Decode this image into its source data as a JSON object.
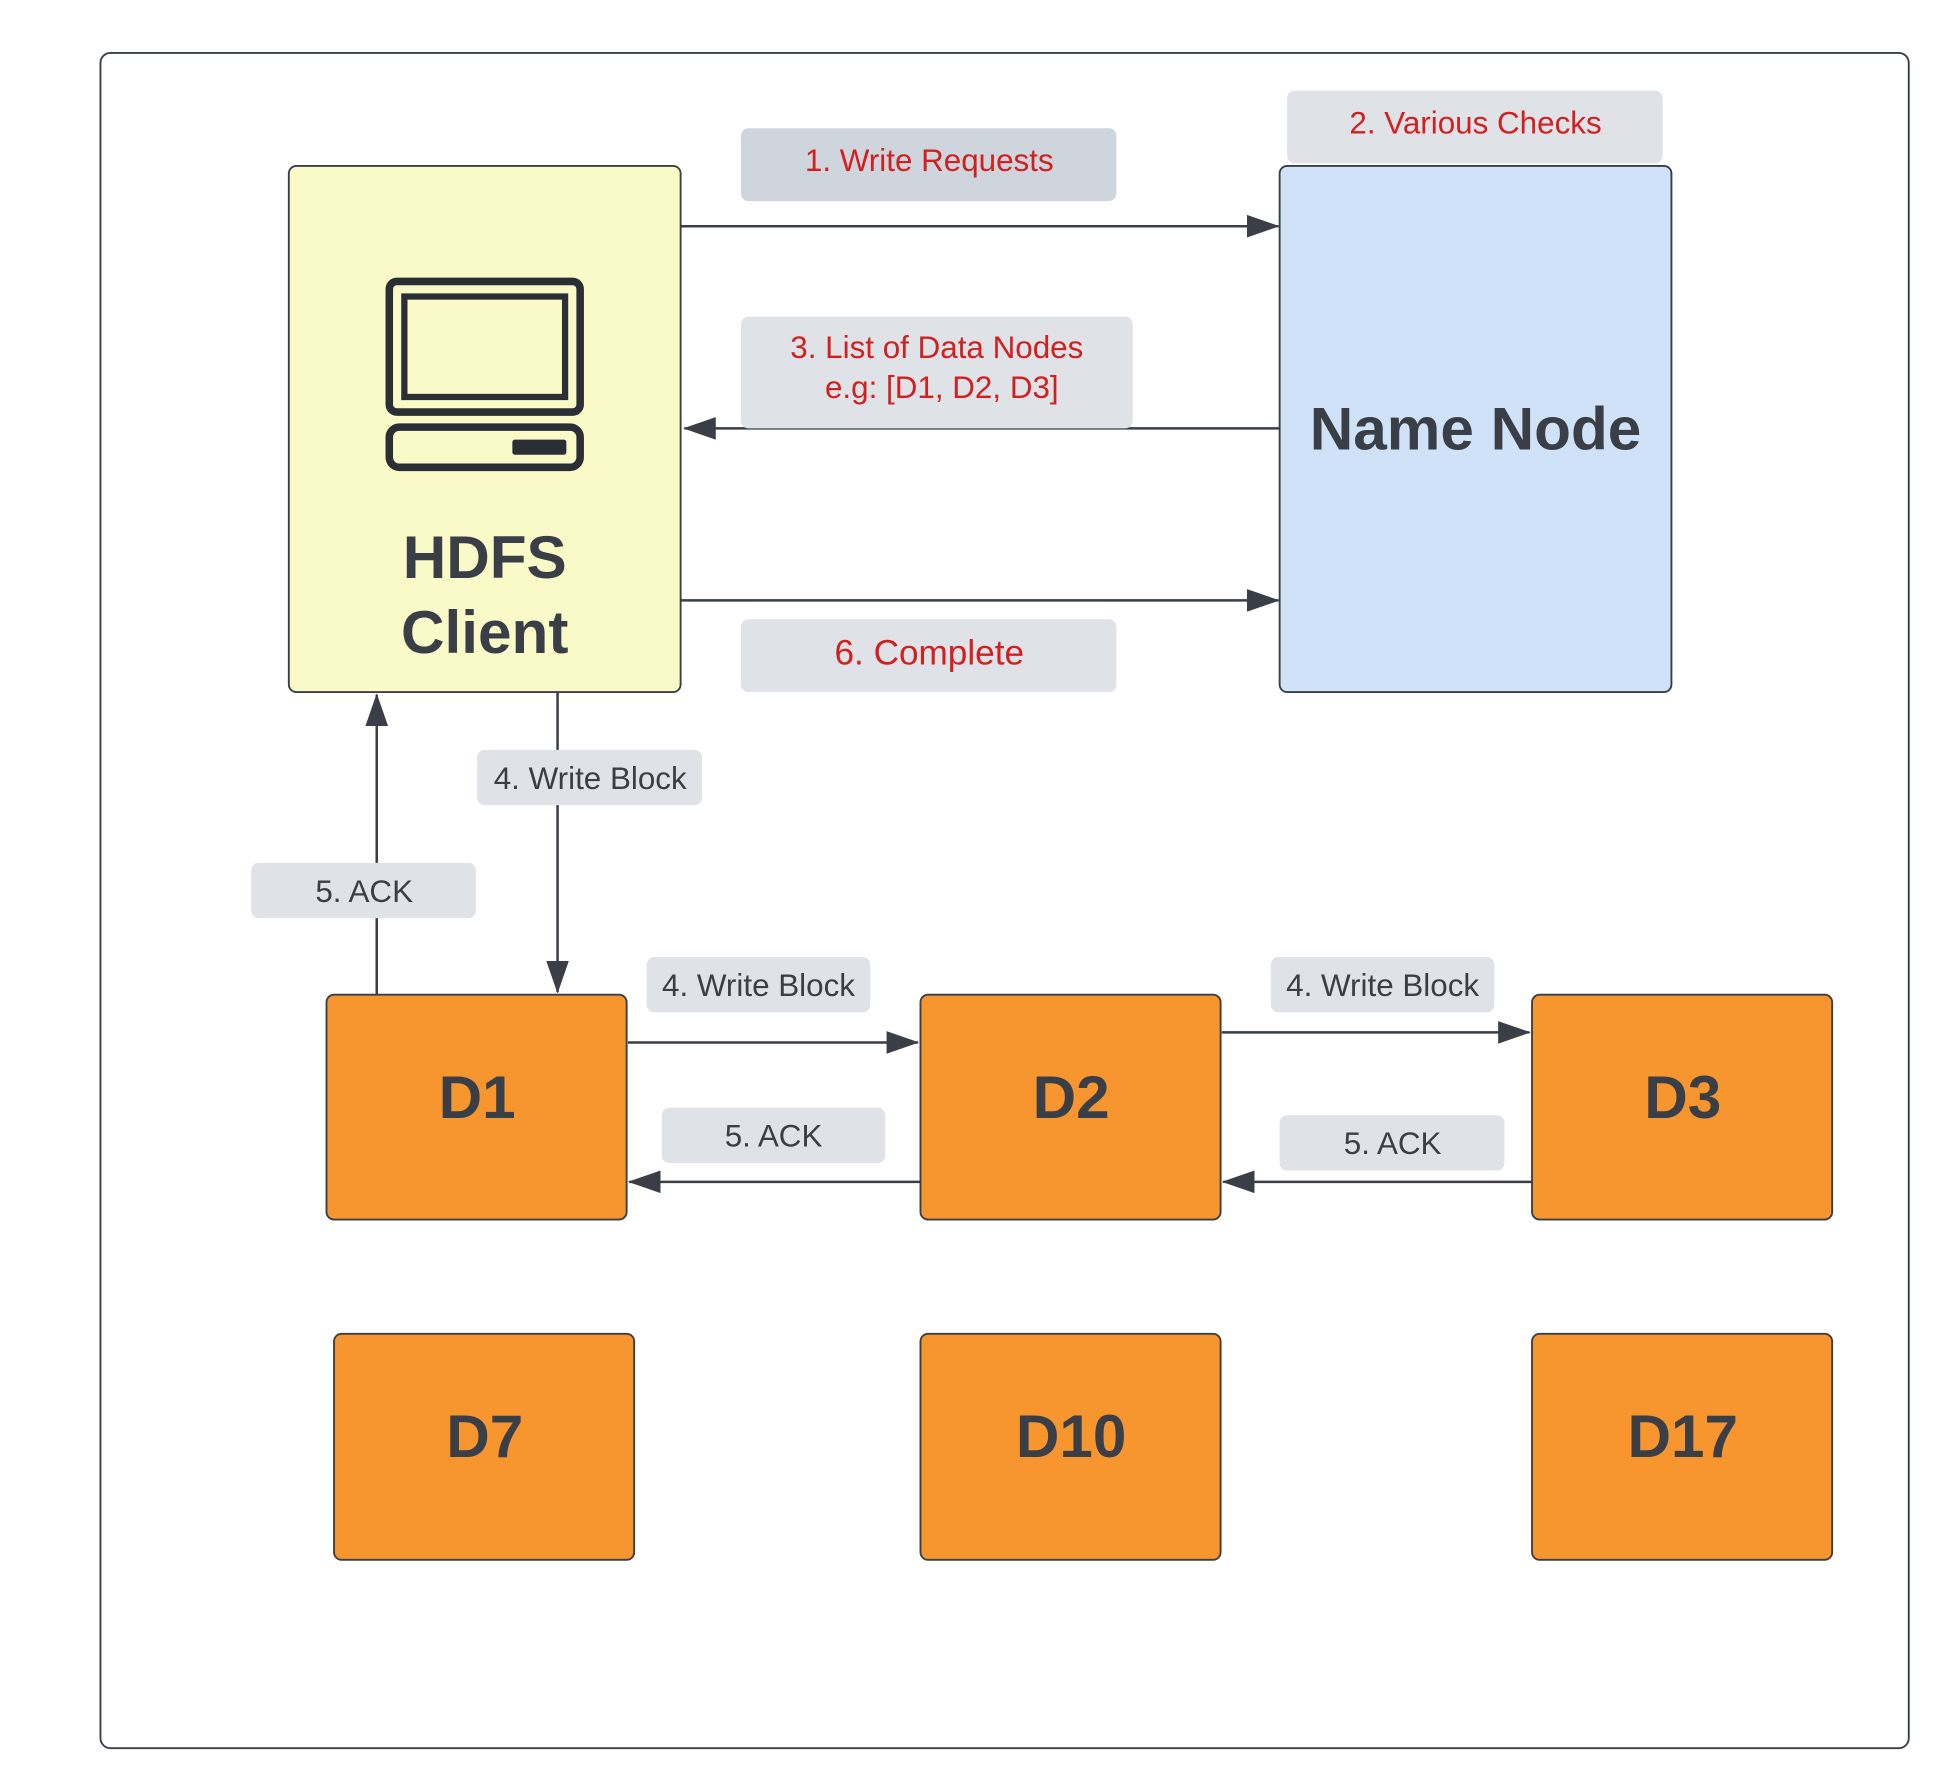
{
  "colors": {
    "client_fill": "#fafac8",
    "namenode_fill": "#cfe2f8",
    "datanode_fill": "#f7952f",
    "label_fill": "#dfe2e6",
    "request_text": "#d21f1f",
    "text_dark": "#3a3f47"
  },
  "client": {
    "title_line1": "HDFS",
    "title_line2": "Client",
    "icon": "computer-monitor-icon"
  },
  "namenode": {
    "title": "Name Node"
  },
  "labels": {
    "write_requests": "1. Write Requests",
    "various_checks": "2. Various Checks",
    "list_line1": "3. List of Data Nodes",
    "list_line2": "e.g: [D1, D2, D3]",
    "complete": "6. Complete",
    "write_block_client": "4. Write Block",
    "ack_client": "5. ACK",
    "write_block_d1_d2": "4. Write Block",
    "write_block_d2_d3": "4. Write Block",
    "ack_d2_d1": "5. ACK",
    "ack_d3_d2": "5. ACK"
  },
  "datanodes": [
    "D1",
    "D2",
    "D3",
    "D7",
    "D10",
    "D17"
  ]
}
